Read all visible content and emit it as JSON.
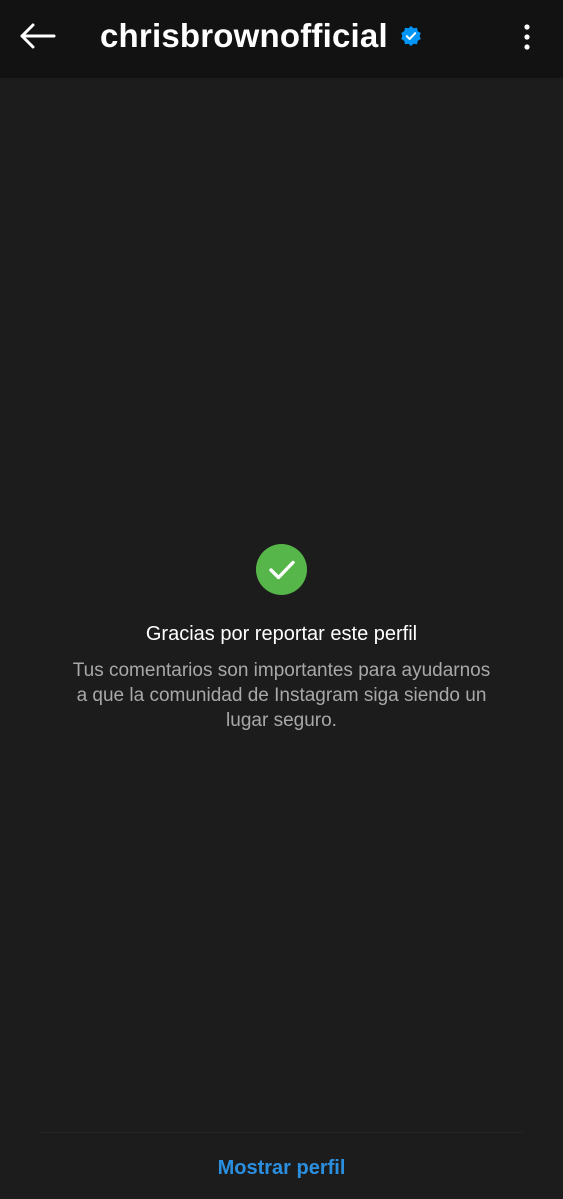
{
  "header": {
    "username": "chrisbrownofficial",
    "back_icon": "arrow-left-icon",
    "verified_icon": "verified-badge-icon",
    "more_icon": "more-vertical-icon"
  },
  "main": {
    "status_icon": "check-circle-icon",
    "heading": "Gracias por reportar este perfil",
    "description": "Tus comentarios son importantes para ayudarnos a que la comunidad de Instagram siga siendo un lugar seguro."
  },
  "footer": {
    "show_profile_label": "Mostrar perfil"
  },
  "colors": {
    "background": "#1c1c1c",
    "header_background": "#121212",
    "success_green": "#57b64a",
    "verified_blue": "#0095f6",
    "link_blue": "#2b8fe0",
    "secondary_text": "#a8a8a8"
  }
}
